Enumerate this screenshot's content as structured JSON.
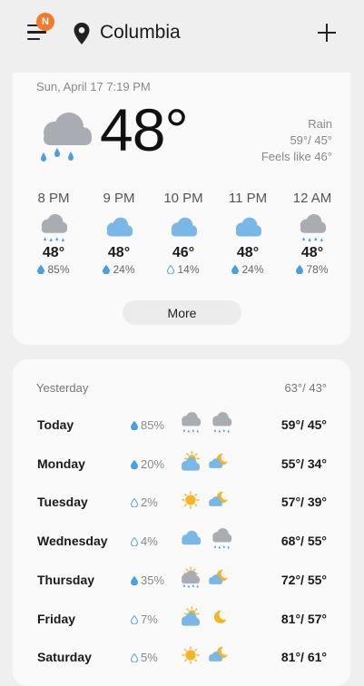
{
  "header": {
    "menu_badge": "N",
    "city": "Columbia"
  },
  "current": {
    "datetime": "Sun, April 17 7:19 PM",
    "temp": "48°",
    "condition": "Rain",
    "high_low": "59°/ 45°",
    "feels_like": "Feels like 46°",
    "icon": "rain-cloud-icon"
  },
  "hourly": [
    {
      "time": "8 PM",
      "temp": "48°",
      "precip": "85%",
      "icon": "rain"
    },
    {
      "time": "9 PM",
      "temp": "48°",
      "precip": "24%",
      "icon": "cloud"
    },
    {
      "time": "10 PM",
      "temp": "46°",
      "precip": "14%",
      "icon": "cloud"
    },
    {
      "time": "11 PM",
      "temp": "48°",
      "precip": "24%",
      "icon": "cloud"
    },
    {
      "time": "12 AM",
      "temp": "48°",
      "precip": "78%",
      "icon": "rain"
    }
  ],
  "more_label": "More",
  "daily": {
    "yesterday_label": "Yesterday",
    "yesterday_temp": "63°/ 43°",
    "days": [
      {
        "name": "Today",
        "precip": "85%",
        "icon_day": "rain",
        "icon_night": "rain",
        "temp": "59°/ 45°"
      },
      {
        "name": "Monday",
        "precip": "20%",
        "icon_day": "partly-sunny",
        "icon_night": "partly-moon",
        "temp": "55°/ 34°"
      },
      {
        "name": "Tuesday",
        "precip": "2%",
        "icon_day": "sun",
        "icon_night": "partly-moon",
        "temp": "57°/ 39°"
      },
      {
        "name": "Wednesday",
        "precip": "4%",
        "icon_day": "cloud",
        "icon_night": "rain",
        "temp": "68°/ 55°"
      },
      {
        "name": "Thursday",
        "precip": "35%",
        "icon_day": "sun-rain",
        "icon_night": "partly-moon",
        "temp": "72°/ 55°"
      },
      {
        "name": "Friday",
        "precip": "7%",
        "icon_day": "partly-sunny",
        "icon_night": "moon",
        "temp": "81°/ 57°"
      },
      {
        "name": "Saturday",
        "precip": "5%",
        "icon_day": "sun",
        "icon_night": "partly-moon",
        "temp": "81°/ 61°"
      }
    ]
  },
  "colors": {
    "badge": "#f07a2d",
    "rain_cloud": "#a9adb3",
    "cloud_blue": "#7ab6e6",
    "drop": "#4b9ee0",
    "sun": "#f5b52a"
  }
}
